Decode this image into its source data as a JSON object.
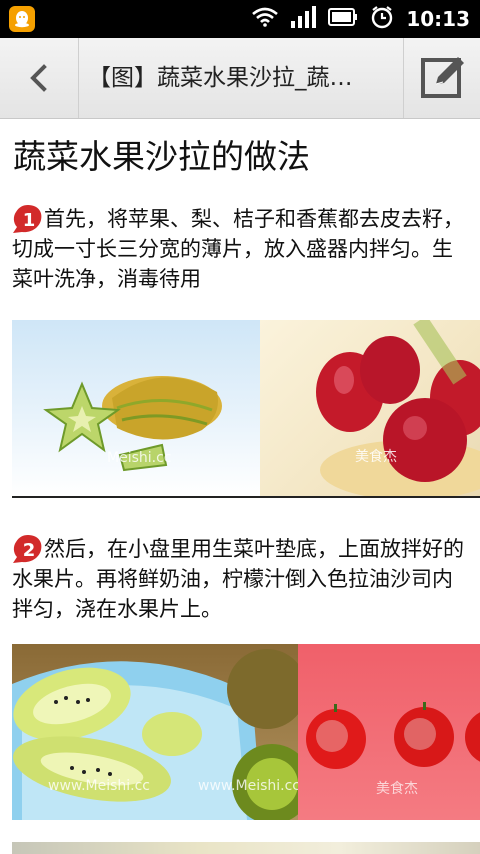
{
  "status_bar": {
    "time": "10:13",
    "icons": [
      "qq-notification-icon",
      "wifi-icon",
      "signal-icon",
      "battery-icon",
      "alarm-clock-icon"
    ]
  },
  "toolbar": {
    "title": "【图】蔬菜水果沙拉_蔬…",
    "back_icon": "chevron-left-icon",
    "edit_icon": "edit-note-icon"
  },
  "article": {
    "title": "蔬菜水果沙拉的做法",
    "steps": [
      {
        "number": "1",
        "text": "首先，将苹果、梨、桔子和香蕉都去皮去籽， 切成一寸长三分宽的薄片，放入盛器内拌匀。生菜叶洗净，消毒待用"
      },
      {
        "number": "2",
        "text": "然后，在小盘里用生菜叶垫底，上面放拌好的水果片。再将鲜奶油，柠檬汁倒入色拉油沙司内拌匀，浇在水果片上。"
      }
    ],
    "watermarks": {
      "row1_a": "Meishi.cc",
      "row1_b": "美食杰",
      "row2_a": "www.Meishi.cc",
      "row2_b": "www.Meishi.cc",
      "row2_c": "美食杰"
    }
  },
  "colors": {
    "status_bar": "#000000",
    "toolbar": "#ebebeb",
    "badge_red": "#d22a2a"
  }
}
